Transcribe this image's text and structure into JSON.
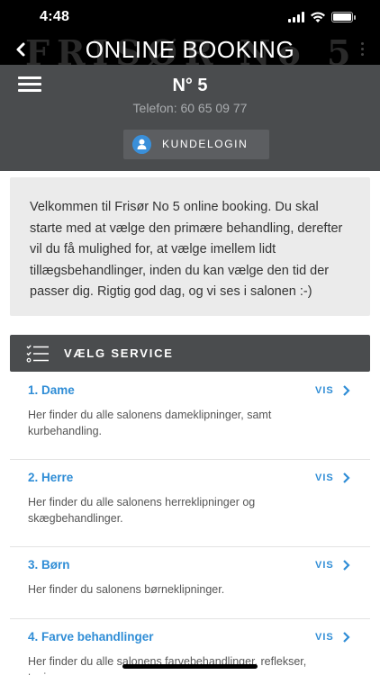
{
  "status_bar": {
    "time": "4:48"
  },
  "title_bar": {
    "title": "ONLINE BOOKING",
    "watermark": "FRISØR No 5"
  },
  "header": {
    "salon_name": "N° 5",
    "phone": "Telefon: 60 65 09 77",
    "login_label": "KUNDELOGIN"
  },
  "welcome": {
    "text": "Velkommen til Frisør No 5 online booking. Du skal starte med at vælge den primære behandling, derefter vil du få mulighed for, at vælge imellem lidt tillægsbehandlinger, inden du kan vælge den tid der passer dig. Rigtig god dag, og vi ses i salonen :-)"
  },
  "services": {
    "title": "VÆLG SERVICE",
    "items": [
      {
        "name": "1. Dame",
        "link": "VIS",
        "description": "Her finder du alle salonens dameklipninger, samt kurbehandling."
      },
      {
        "name": "2. Herre",
        "link": "VIS",
        "description": "Her finder du alle salonens herreklipninger og skægbehandlinger."
      },
      {
        "name": "3. Børn",
        "link": "VIS",
        "description": "Her finder du salonens børneklipninger."
      },
      {
        "name": "4. Farve behandlinger",
        "link": "VIS",
        "description": "Her finder du alle salonens farvebehandlinger, reflekser, toninger mv."
      }
    ]
  },
  "colors": {
    "accent": "#2f8dd6",
    "header_bg": "#4a4c4e",
    "login_icon": "#3a8fd9"
  },
  "icons": [
    "back-icon",
    "menu-icon",
    "user-icon",
    "checklist-icon",
    "chevron-right-icon"
  ]
}
